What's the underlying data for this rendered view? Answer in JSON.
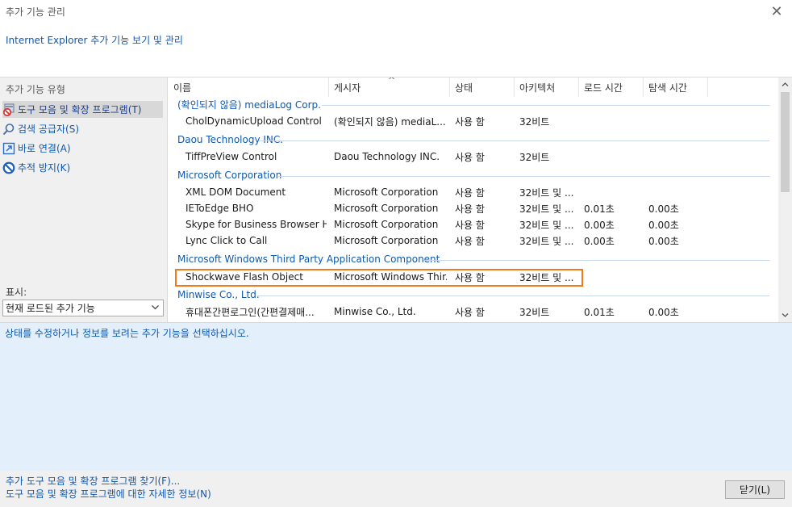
{
  "window": {
    "title": "추가 기능 관리",
    "close_glyph": "✕"
  },
  "header": {
    "link_text": "Internet Explorer 추가 기능 보기 및 관리"
  },
  "left": {
    "heading": "추가 기능 유형",
    "items": [
      {
        "label": "도구 모음 및 확장 프로그램(T)",
        "icon": "toolbar-extension-icon",
        "selected": true
      },
      {
        "label": "검색 공급자(S)",
        "icon": "search-icon",
        "selected": false
      },
      {
        "label": "바로 연결(A)",
        "icon": "accelerator-icon",
        "selected": false
      },
      {
        "label": "추적 방지(K)",
        "icon": "tracking-protection-icon",
        "selected": false
      }
    ],
    "show_label": "표시:",
    "show_value": "현재 로드된 추가 기능"
  },
  "list": {
    "columns": [
      "이름",
      "게시자",
      "상태",
      "아키텍처",
      "로드 시간",
      "탐색 시간"
    ],
    "sort_glyph": "^",
    "groups": [
      {
        "name": "(확인되지 않음) mediaLog Corp.",
        "rows": [
          {
            "name": "CholDynamicUpload Control",
            "publisher": "(확인되지 않음) mediaL...",
            "status": "사용 함",
            "arch": "32비트",
            "load": "",
            "nav": ""
          }
        ]
      },
      {
        "name": "Daou Technology INC.",
        "rows": [
          {
            "name": "TiffPreView Control",
            "publisher": "Daou Technology INC.",
            "status": "사용 함",
            "arch": "32비트",
            "load": "",
            "nav": ""
          }
        ]
      },
      {
        "name": "Microsoft Corporation",
        "rows": [
          {
            "name": "XML DOM Document",
            "publisher": "Microsoft Corporation",
            "status": "사용 함",
            "arch": "32비트 및 ...",
            "load": "",
            "nav": ""
          },
          {
            "name": "IEToEdge BHO",
            "publisher": "Microsoft Corporation",
            "status": "사용 함",
            "arch": "32비트 및 ...",
            "load": "0.01초",
            "nav": "0.00초"
          },
          {
            "name": "Skype for Business Browser He...",
            "publisher": "Microsoft Corporation",
            "status": "사용 함",
            "arch": "32비트 및 ...",
            "load": "0.00초",
            "nav": "0.00초"
          },
          {
            "name": "Lync Click to Call",
            "publisher": "Microsoft Corporation",
            "status": "사용 함",
            "arch": "32비트 및 ...",
            "load": "0.00초",
            "nav": "0.00초"
          }
        ]
      },
      {
        "name": "Microsoft Windows Third Party Application Component",
        "rows": [
          {
            "name": "Shockwave Flash Object",
            "publisher": "Microsoft Windows Thir...",
            "status": "사용 함",
            "arch": "32비트 및 ...",
            "load": "",
            "nav": ""
          }
        ]
      },
      {
        "name": "Minwise Co., Ltd.",
        "rows": [
          {
            "name": "휴대폰간편로그인(간편결제매...",
            "publisher": "Minwise Co., Ltd.",
            "status": "사용 함",
            "arch": "32비트",
            "load": "0.01초",
            "nav": "0.00초"
          }
        ]
      }
    ]
  },
  "details": {
    "text": "상태를 수정하거나 정보를 보려는 추가 기능을 선택하십시오."
  },
  "footer": {
    "link1": "추가 도구 모음 및 확장 프로그램 찾기(F)...",
    "link2": "도구 모음 및 확장 프로그램에 대한 자세한 정보(N)",
    "close_label": "닫기(L)"
  },
  "colors": {
    "link": "#0d58b0",
    "highlight": "#f07a1a",
    "details_bg": "#e3f0fb"
  }
}
